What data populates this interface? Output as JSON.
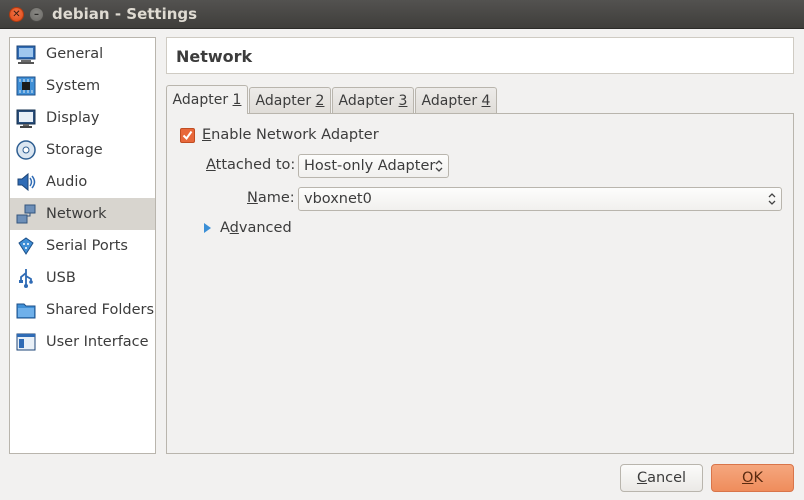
{
  "window": {
    "title": "debian - Settings"
  },
  "sidebar": {
    "items": [
      {
        "label": "General",
        "icon": "general-icon",
        "selected": false
      },
      {
        "label": "System",
        "icon": "system-chip-icon",
        "selected": false
      },
      {
        "label": "Display",
        "icon": "display-monitor-icon",
        "selected": false
      },
      {
        "label": "Storage",
        "icon": "storage-disk-icon",
        "selected": false
      },
      {
        "label": "Audio",
        "icon": "audio-speaker-icon",
        "selected": false
      },
      {
        "label": "Network",
        "icon": "network-icon",
        "selected": true
      },
      {
        "label": "Serial Ports",
        "icon": "serial-port-icon",
        "selected": false
      },
      {
        "label": "USB",
        "icon": "usb-icon",
        "selected": false
      },
      {
        "label": "Shared Folders",
        "icon": "shared-folder-icon",
        "selected": false
      },
      {
        "label": "User Interface",
        "icon": "user-interface-icon",
        "selected": false
      }
    ]
  },
  "header": {
    "title": "Network"
  },
  "tabs": [
    {
      "prefix": "Adapter ",
      "mnemonic": "1",
      "active": true
    },
    {
      "prefix": "Adapter ",
      "mnemonic": "2",
      "active": false
    },
    {
      "prefix": "Adapter ",
      "mnemonic": "3",
      "active": false
    },
    {
      "prefix": "Adapter ",
      "mnemonic": "4",
      "active": false
    }
  ],
  "adapter": {
    "enable": {
      "mnemonic": "E",
      "rest": "nable Network Adapter",
      "checked": true
    },
    "attached": {
      "mnemonic": "A",
      "rest": "ttached to:",
      "value": "Host-only Adapter"
    },
    "name": {
      "mnemonic": "N",
      "rest": "ame:",
      "value": "vboxnet0"
    },
    "advanced": {
      "prefix": "A",
      "mnemonic": "d",
      "rest": "vanced"
    }
  },
  "buttons": {
    "cancel": {
      "mnemonic": "C",
      "rest": "ancel"
    },
    "ok": {
      "mnemonic": "O",
      "rest": "K"
    }
  },
  "colors": {
    "accent": "#e8683b",
    "selected_bg": "#d8d5cf",
    "expander": "#3b8fd6"
  }
}
